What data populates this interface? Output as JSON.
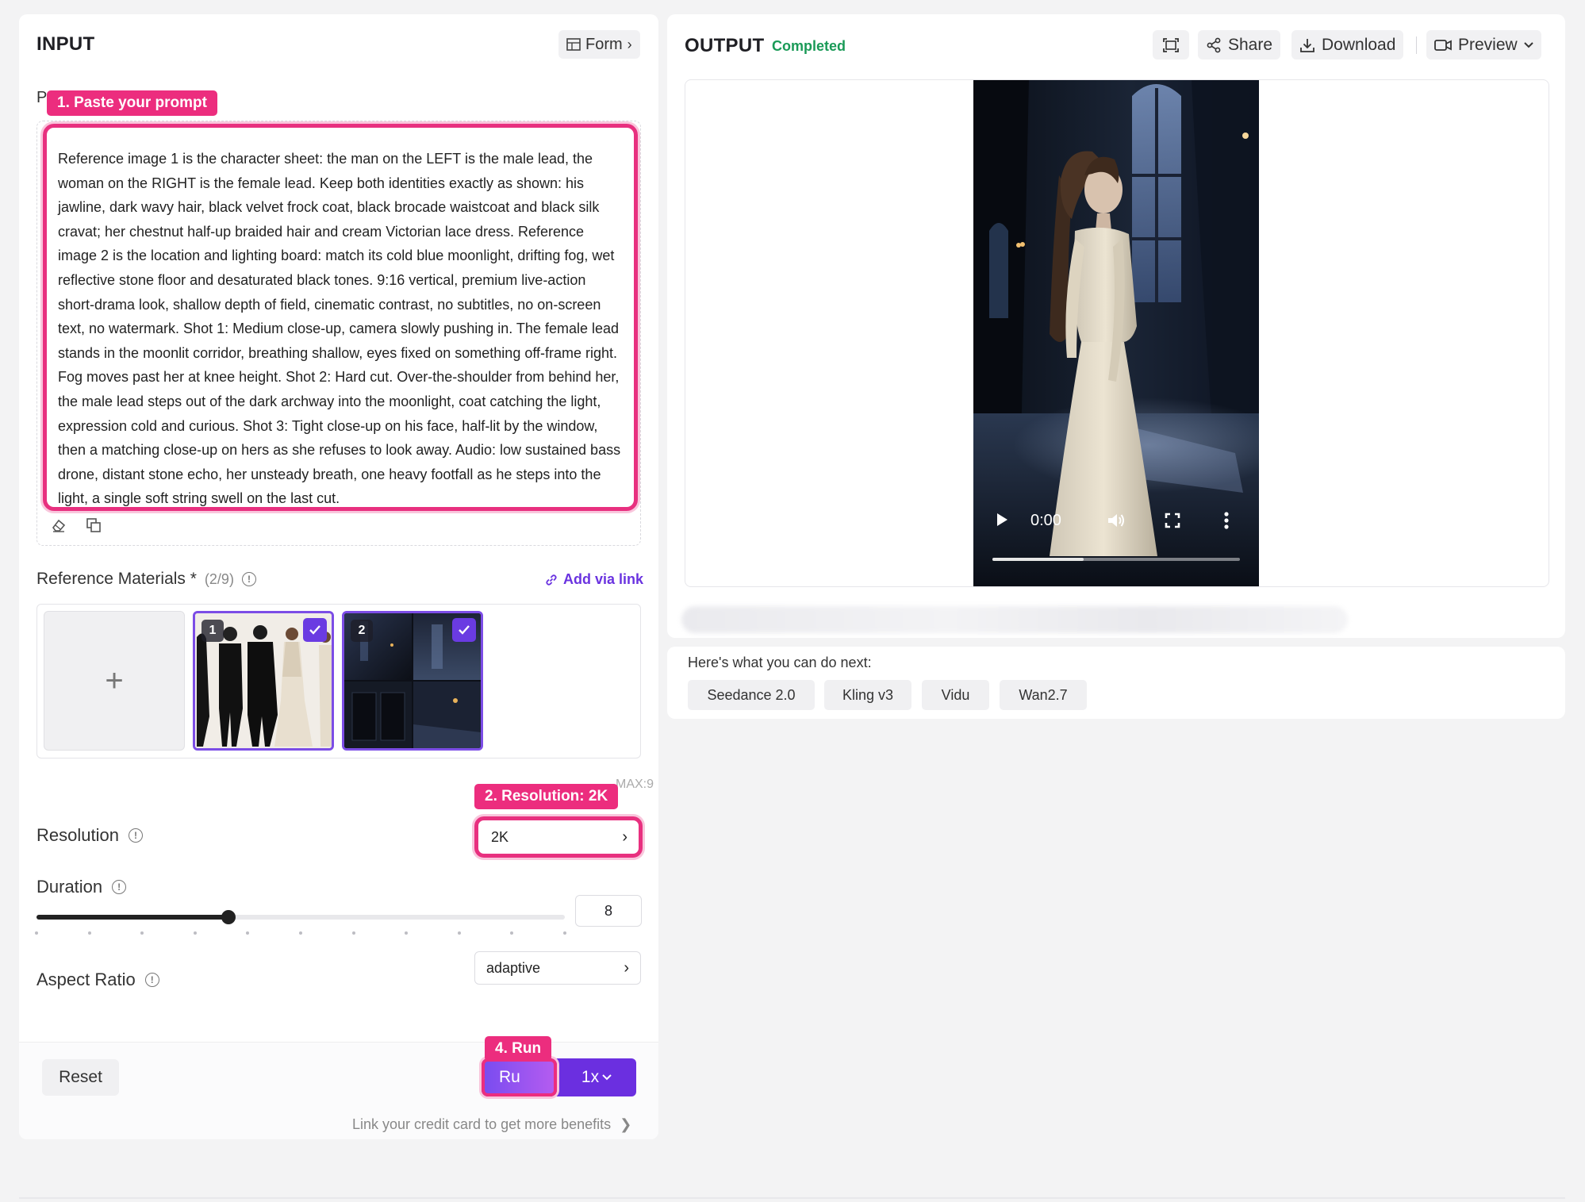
{
  "input": {
    "title": "INPUT",
    "form_toggle_label": "Form",
    "prompt_label": "P",
    "prompt_callout": "1. Paste your prompt",
    "prompt_text": "Reference image 1 is the character sheet: the man on the LEFT is the male lead, the woman on the RIGHT is the female lead. Keep both identities exactly as shown: his jawline, dark wavy hair, black velvet frock coat, black brocade waistcoat and black silk cravat; her chestnut half-up braided hair and cream Victorian lace dress. Reference image 2 is the location and lighting board: match its cold blue moonlight, drifting fog, wet reflective stone floor and desaturated black tones. 9:16 vertical, premium live-action short-drama look, shallow depth of field, cinematic contrast, no subtitles, no on-screen text, no watermark. Shot 1: Medium close-up, camera slowly pushing in. The female lead stands in the moonlit corridor, breathing shallow, eyes fixed on something off-frame right. Fog moves past her at knee height. Shot 2: Hard cut. Over-the-shoulder from behind her, the male lead steps out of the dark archway into the moonlight, coat catching the light, expression cold and curious. Shot 3: Tight close-up on his face, half-lit by the window, then a matching close-up on hers as she refuses to look away. Audio: low sustained bass drone, distant stone echo, her unsteady breath, one heavy footfall as he steps into the light, a single soft string swell on the last cut.",
    "reference": {
      "label": "Reference Materials *",
      "count": "(2/9)",
      "add_link": "Add via link",
      "add_tile": "+",
      "thumbs": [
        {
          "num": "1",
          "selected": true
        },
        {
          "num": "2",
          "selected": true
        }
      ],
      "max_label": "MAX:9"
    },
    "resolution": {
      "label": "Resolution",
      "callout": "2. Resolution: 2K",
      "value": "2K"
    },
    "duration": {
      "label": "Duration",
      "value": "8",
      "min": 4,
      "max": 15
    },
    "aspect_ratio": {
      "label": "Aspect Ratio",
      "value": "adaptive"
    },
    "footer": {
      "reset_label": "Reset",
      "run_callout": "4. Run",
      "run_label": "Ru",
      "multiplier_label": "1x",
      "credit_link": "Link your credit card to get more benefits"
    }
  },
  "output": {
    "title": "OUTPUT",
    "status": "Completed",
    "share_label": "Share",
    "download_label": "Download",
    "preview_label": "Preview",
    "video": {
      "time": "0:00",
      "progress": 0.37
    }
  },
  "next": {
    "title": "Here's what you can do next:",
    "chips": [
      "Seedance 2.0",
      "Kling v3",
      "Vidu",
      "Wan2.7"
    ]
  },
  "colors": {
    "accent_purple": "#6b2fe0",
    "callout_pink": "#ec2d7e",
    "status_green": "#1a9a57"
  }
}
